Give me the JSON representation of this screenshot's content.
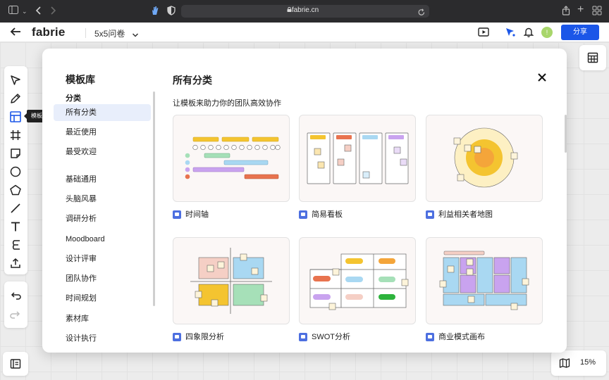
{
  "browser": {
    "url": "fabrie.cn"
  },
  "header": {
    "logo": "fabrie",
    "board_name": "5x5问卷",
    "share_label": "分享",
    "avatar_initial": "!"
  },
  "toolbar": {
    "tooltip": "模板"
  },
  "zoom": {
    "level": "15%"
  },
  "modal": {
    "title": "模板库",
    "section_label": "分类",
    "categories": [
      {
        "label": "所有分类",
        "active": true
      },
      {
        "label": "最近使用"
      },
      {
        "label": "最受欢迎"
      },
      {
        "label": "基础通用"
      },
      {
        "label": "头脑风暴"
      },
      {
        "label": "调研分析"
      },
      {
        "label": "Moodboard"
      },
      {
        "label": "设计评审"
      },
      {
        "label": "团队协作"
      },
      {
        "label": "时间规划"
      },
      {
        "label": "素材库"
      },
      {
        "label": "设计执行"
      }
    ],
    "main_title": "所有分类",
    "subtitle": "让模板来助力你的团队高效协作",
    "templates": [
      {
        "name": "时间轴",
        "icon": "template-board-icon"
      },
      {
        "name": "简易看板",
        "icon": "template-board-icon"
      },
      {
        "name": "利益相关者地图",
        "icon": "template-board-icon"
      },
      {
        "name": "四象限分析",
        "icon": "template-board-icon"
      },
      {
        "name": "SWOT分析",
        "icon": "template-board-icon"
      },
      {
        "name": "商业模式画布",
        "icon": "template-board-icon"
      }
    ]
  },
  "colors": {
    "accent": "#1b56e8",
    "active_category_bg": "#e8eefb",
    "yellow": "#f4c430",
    "orange": "#e8734f",
    "blue": "#a9d8f2",
    "purple": "#c9a3ef",
    "green": "#a6e0b8"
  }
}
